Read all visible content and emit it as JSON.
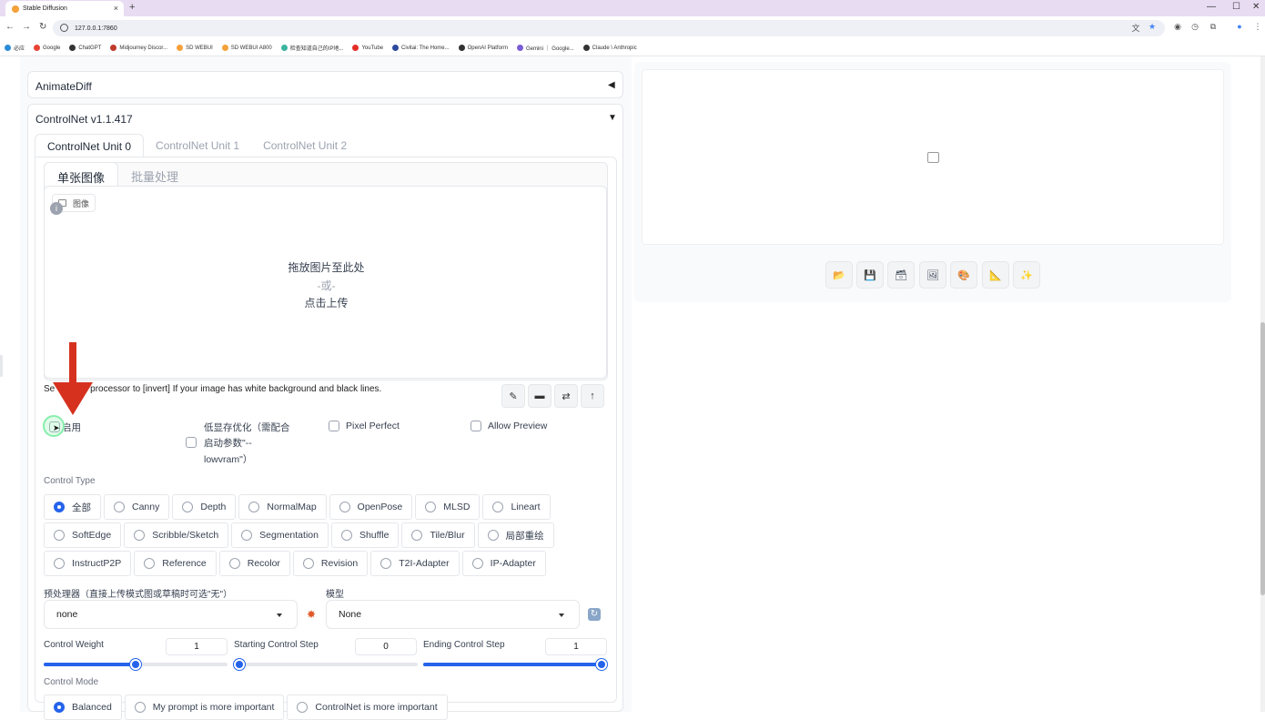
{
  "browser": {
    "tab_title": "Stable Diffusion",
    "tab_close": "×",
    "new_tab": "+",
    "url": "127.0.0.1:7860",
    "bookmarks": [
      {
        "label": "必应",
        "color": "#2a8cd8"
      },
      {
        "label": "Google",
        "color": "#ea4335"
      },
      {
        "label": "ChatGPT",
        "color": "#333333"
      },
      {
        "label": "Midjourney Discor...",
        "color": "#c0392b"
      },
      {
        "label": "SD WEBUI",
        "color": "#f4a13a"
      },
      {
        "label": "SD WEBUI A800",
        "color": "#f4a13a"
      },
      {
        "label": "检查知道自己的IP地...",
        "color": "#3cb4a0"
      },
      {
        "label": "YouTube",
        "color": "#e52d27"
      },
      {
        "label": "Civitai: The Home...",
        "color": "#2e4a9e"
      },
      {
        "label": "OpenAI Platform",
        "color": "#333333"
      },
      {
        "label": "Gemini ｜ Google...",
        "color": "#7b5cd6"
      },
      {
        "label": "Claude \\ Anthropic",
        "color": "#333333"
      }
    ]
  },
  "accordions": {
    "animatediff": "AnimateDiff",
    "controlnet": "ControlNet v1.1.417"
  },
  "unit_tabs": [
    "ControlNet Unit 0",
    "ControlNet Unit 1",
    "ControlNet Unit 2"
  ],
  "image_tabs": [
    "单张图像",
    "批量处理"
  ],
  "upload": {
    "tag": "图像",
    "drop": "拖放图片至此处",
    "or": "-或-",
    "click": "点击上传"
  },
  "hint": "Set the preprocessor to [invert] If your image has white background and black lines.",
  "hint_visible": "Se              processor to [invert] If your image has white background and black lines.",
  "options": {
    "enable": "启用",
    "lowvram_1": "低显存优化（需配合",
    "lowvram_2": "启动参数\"--",
    "lowvram_3": "lowvram\"）",
    "pixel_perfect": "Pixel Perfect",
    "allow_preview": "Allow Preview"
  },
  "control_type": {
    "label": "Control Type",
    "row1": [
      "全部",
      "Canny",
      "Depth",
      "NormalMap",
      "OpenPose",
      "MLSD",
      "Lineart"
    ],
    "row2": [
      "SoftEdge",
      "Scribble/Sketch",
      "Segmentation",
      "Shuffle",
      "Tile/Blur",
      "局部重绘"
    ],
    "row3": [
      "InstructP2P",
      "Reference",
      "Recolor",
      "Revision",
      "T2I-Adapter",
      "IP-Adapter"
    ],
    "selected": "全部"
  },
  "preprocessor": {
    "label": "预处理器（直接上传模式图或草稿时可选\"无\"）",
    "value": "none"
  },
  "model": {
    "label": "模型",
    "value": "None"
  },
  "sliders": {
    "weight": {
      "label": "Control Weight",
      "value": "1",
      "fraction": 0.5
    },
    "start": {
      "label": "Starting Control Step",
      "value": "0",
      "fraction": 0.0
    },
    "end": {
      "label": "Ending Control Step",
      "value": "1",
      "fraction": 1.0
    }
  },
  "control_mode": {
    "label": "Control Mode",
    "options": [
      "Balanced",
      "My prompt is more important",
      "ControlNet is more important"
    ],
    "selected": "Balanced"
  },
  "colors": {
    "accent": "#2563eb",
    "arrow": "#d6311f"
  }
}
